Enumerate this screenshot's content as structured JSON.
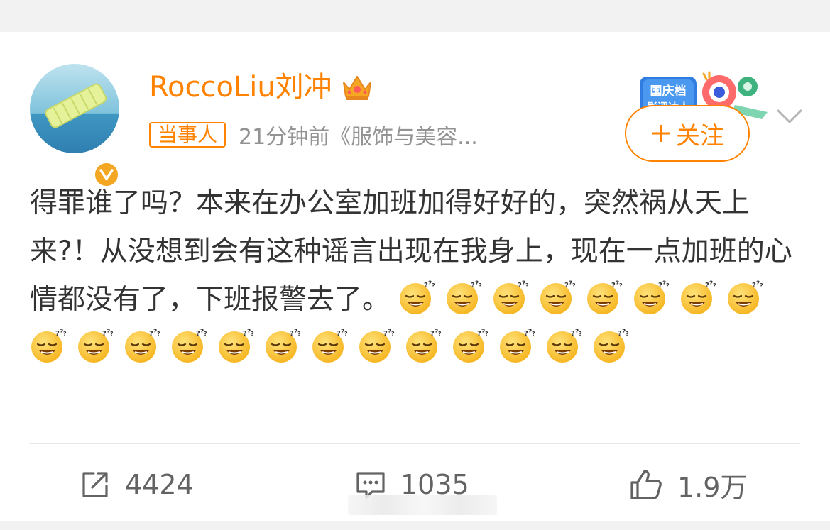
{
  "post": {
    "author": {
      "name": "RoccoLiu刘冲",
      "tag": "当事人",
      "verified_icon": "verified-v-icon",
      "crown_icon": "crown-icon"
    },
    "meta": "21分钟前《服饰与美容...",
    "follow_label": "关注",
    "follow_icon": "plus",
    "badge": {
      "line1": "国庆档",
      "line2": "影评达人"
    },
    "text": "得罪谁了吗？本来在办公室加班加得好好的，突然祸从天上来?！从没想到会有这种谣言出现在我身上，现在一点加班的心情都没有了，下班报警去了。",
    "emoji_icon": "sleepy-face-emoji",
    "emoji_count": 21
  },
  "actions": {
    "repost_count": "4424",
    "comment_count": "1035",
    "like_count": "1.9万"
  },
  "colors": {
    "accent": "#ff8200",
    "text": "#333333",
    "muted": "#939393"
  }
}
